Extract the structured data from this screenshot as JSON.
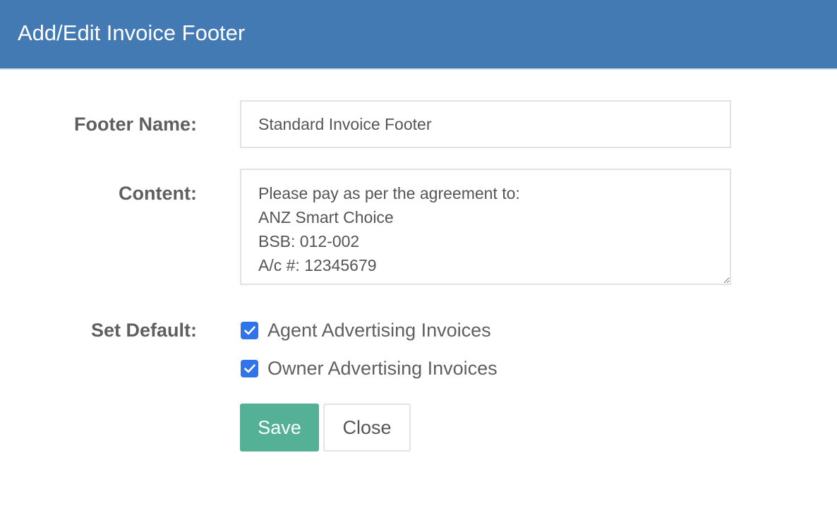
{
  "dialog": {
    "title": "Add/Edit Invoice Footer"
  },
  "form": {
    "footer_name": {
      "label": "Footer Name:",
      "value": "Standard Invoice Footer"
    },
    "content": {
      "label": "Content:",
      "value": "Please pay as per the agreement to:\nANZ Smart Choice\nBSB: 012-002\nA/c #: 12345679"
    },
    "set_default": {
      "label": "Set Default:",
      "options": [
        {
          "label": "Agent Advertising Invoices",
          "checked": true
        },
        {
          "label": "Owner Advertising Invoices",
          "checked": true
        }
      ]
    }
  },
  "buttons": {
    "save_label": "Save",
    "close_label": "Close"
  },
  "colors": {
    "header_bg": "#437ab3",
    "save_bg": "#55b196",
    "checkbox_accent": "#2f74e8"
  },
  "icons": {
    "checkbox_checked": "checkmark-icon"
  }
}
